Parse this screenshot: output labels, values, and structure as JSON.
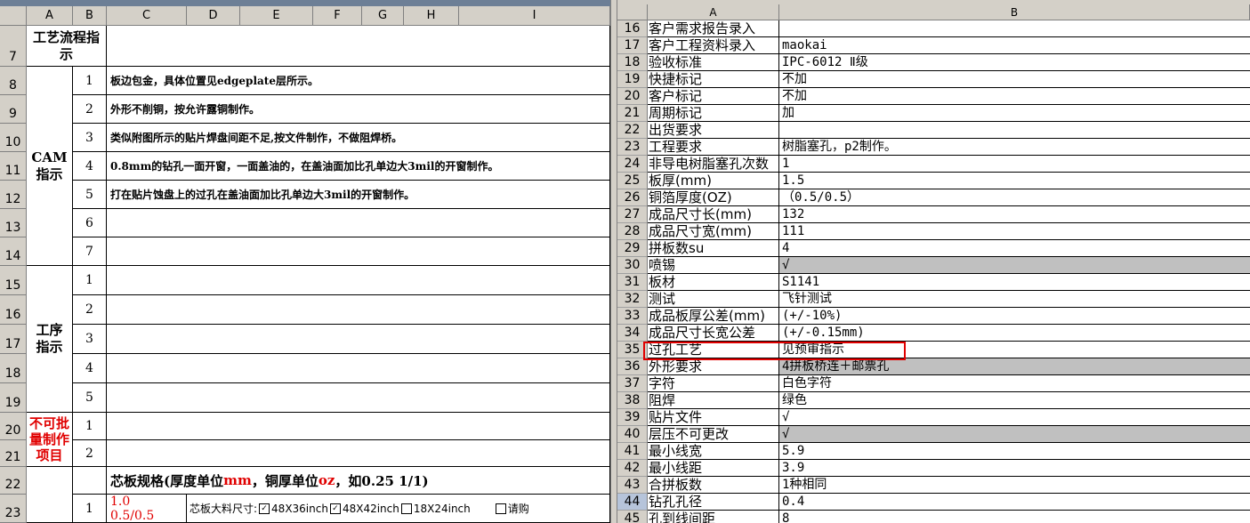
{
  "left": {
    "titlebar": "",
    "columns": [
      "A",
      "B",
      "C",
      "D",
      "E",
      "F",
      "G",
      "H",
      "I"
    ],
    "row_numbers": [
      "7",
      "8",
      "9",
      "10",
      "11",
      "12",
      "13",
      "14",
      "15",
      "16",
      "17",
      "18",
      "19",
      "20",
      "21",
      "22",
      "23"
    ],
    "sections": {
      "process_flow": "工艺流程指示",
      "cam": "CAM指示",
      "process": "工序指示",
      "no_batch": "不可批量制作项目"
    },
    "cam_items": [
      {
        "n": "1",
        "text": "板边包金，具体位置见edgeplate层所示。"
      },
      {
        "n": "2",
        "text": "外形不削铜，按允许露铜制作。"
      },
      {
        "n": "3",
        "text": "类似附图所示的贴片焊盘间距不足,按文件制作，不做阻焊桥。"
      },
      {
        "n": "4",
        "text": "0.8mm的钻孔一面开窗，一面盖油的，在盖油面加比孔单边大3mil的开窗制作。"
      },
      {
        "n": "5",
        "text": "打在贴片蚀盘上的过孔在盖油面加比孔单边大3mil的开窗制作。"
      },
      {
        "n": "6",
        "text": ""
      },
      {
        "n": "7",
        "text": ""
      }
    ],
    "process_items": [
      "1",
      "2",
      "3",
      "4",
      "5"
    ],
    "no_batch_items": [
      "1",
      "2"
    ],
    "core_title_1": "芯板规格(厚度单位",
    "core_title_mm": "mm",
    "core_title_2": "，铜厚单位",
    "core_title_oz": "oz",
    "core_title_3": "，如0.25 1/1)",
    "core_row": {
      "n": "1",
      "value_1": "1.0",
      "value_2": "0.5/0.5",
      "size_label": "芯板大料尺寸:",
      "opt1": "48X36inch",
      "opt2": "48X42inch",
      "opt3": "18X24inch",
      "opt4": "请购"
    }
  },
  "right": {
    "columns": [
      "A",
      "B"
    ],
    "rows": [
      {
        "n": "16",
        "a": "客户需求报告录入",
        "b": ""
      },
      {
        "n": "17",
        "a": "客户工程资料录入",
        "b": "maokai"
      },
      {
        "n": "18",
        "a": "验收标准",
        "b": "IPC-6012 Ⅱ级"
      },
      {
        "n": "19",
        "a": "快捷标记",
        "b": "不加"
      },
      {
        "n": "20",
        "a": "客户标记",
        "b": "不加"
      },
      {
        "n": "21",
        "a": "周期标记",
        "b": "加"
      },
      {
        "n": "22",
        "a": "出货要求",
        "b": ""
      },
      {
        "n": "23",
        "a": "工程要求",
        "b": "树脂塞孔，p2制作。"
      },
      {
        "n": "24",
        "a": "非导电树脂塞孔次数",
        "b": "1"
      },
      {
        "n": "25",
        "a": "板厚(mm)",
        "b": "1.5"
      },
      {
        "n": "26",
        "a": "铜箔厚度(OZ)",
        "b": "（0.5/0.5）"
      },
      {
        "n": "27",
        "a": "成品尺寸长(mm)",
        "b": "132"
      },
      {
        "n": "28",
        "a": "成品尺寸宽(mm)",
        "b": "111"
      },
      {
        "n": "29",
        "a": "拼板数su",
        "b": "4"
      },
      {
        "n": "30",
        "a": "喷锡",
        "b": "√",
        "gray": true
      },
      {
        "n": "31",
        "a": "板材",
        "b": "S1141"
      },
      {
        "n": "32",
        "a": "测试",
        "b": "飞针测试"
      },
      {
        "n": "33",
        "a": "成品板厚公差(mm)",
        "b": "(+/-10%)"
      },
      {
        "n": "34",
        "a": "成品尺寸长宽公差",
        "b": "(+/-0.15mm)"
      },
      {
        "n": "35",
        "a": "过孔工艺",
        "b": "见预审指示"
      },
      {
        "n": "36",
        "a": "外形要求",
        "b": "4拼板桥连＋邮票孔",
        "gray": true
      },
      {
        "n": "37",
        "a": "字符",
        "b": "白色字符"
      },
      {
        "n": "38",
        "a": "阻焊",
        "b": "绿色"
      },
      {
        "n": "39",
        "a": "贴片文件",
        "b": "√"
      },
      {
        "n": "40",
        "a": "层压不可更改",
        "b": "√",
        "gray": true
      },
      {
        "n": "41",
        "a": "最小线宽",
        "b": "5.9"
      },
      {
        "n": "42",
        "a": "最小线距",
        "b": "3.9"
      },
      {
        "n": "43",
        "a": "合拼板数",
        "b": "1种相同"
      },
      {
        "n": "44",
        "a": "钻孔孔径",
        "b": "0.4",
        "selected": true
      },
      {
        "n": "45",
        "a": "孔到线间距",
        "b": "8"
      }
    ]
  },
  "colors": {
    "red": "#e00000",
    "header": "#d4d0c8",
    "gray_cell": "#c0c0c0"
  }
}
